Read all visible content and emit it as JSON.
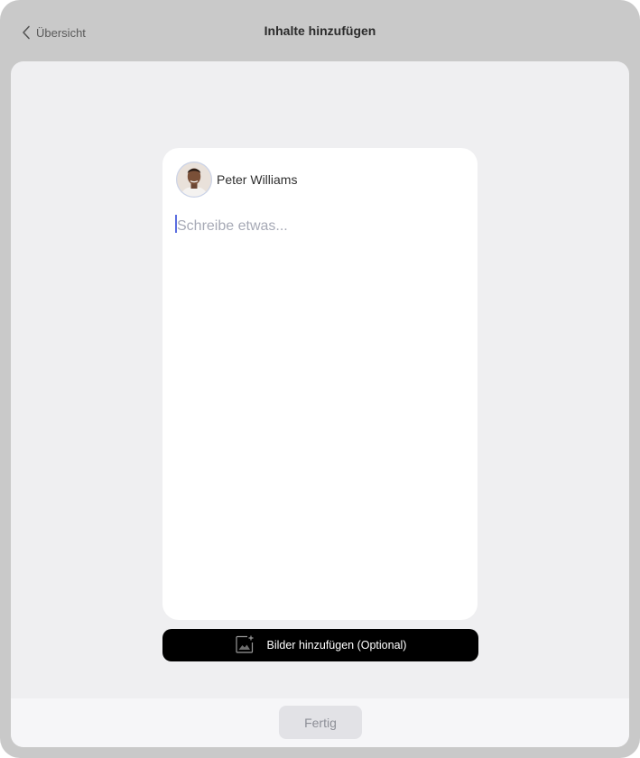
{
  "header": {
    "back_label": "Übersicht",
    "title": "Inhalte hinzufügen"
  },
  "post": {
    "author_name": "Peter Williams",
    "placeholder": "Schreibe etwas...",
    "value": ""
  },
  "actions": {
    "add_images_label": "Bilder hinzufügen (Optional)",
    "add_images_icon": "image-plus-icon",
    "done_label": "Fertig"
  },
  "colors": {
    "outer_background": "#c9c9c9",
    "sheet_background": "#efeff1",
    "primary_button": "#000000",
    "disabled_button": "#e2e2e6",
    "caret": "#5b6ee0"
  }
}
